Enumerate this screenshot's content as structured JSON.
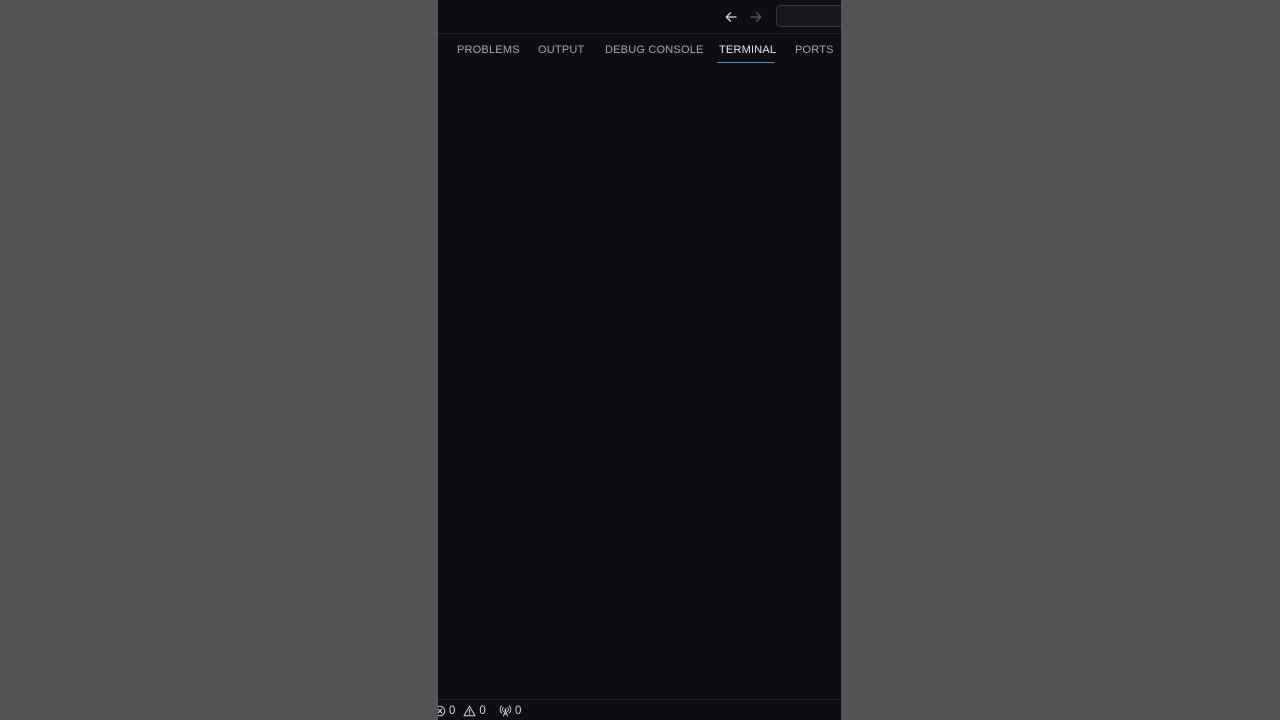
{
  "titlebar": {
    "back_icon": "arrow-left-icon",
    "forward_icon": "arrow-right-icon",
    "search": {
      "value": "",
      "placeholder": ""
    }
  },
  "panel": {
    "tabs": [
      {
        "label": "PROBLEMS",
        "active": false
      },
      {
        "label": "OUTPUT",
        "active": false
      },
      {
        "label": "DEBUG CONSOLE",
        "active": false
      },
      {
        "label": "TERMINAL",
        "active": true
      },
      {
        "label": "PORTS",
        "active": false
      }
    ],
    "accent_color": "#4f86e6"
  },
  "statusbar": {
    "errors": "0",
    "warnings": "0",
    "ports": "0",
    "error_icon": "error-circle-icon",
    "warning_icon": "warning-triangle-icon",
    "ports_icon": "radio-tower-icon"
  },
  "colors": {
    "background": "#545454",
    "window": "#0e0d11",
    "text": "#a8a8ad",
    "active_text": "#e8e8ea"
  }
}
